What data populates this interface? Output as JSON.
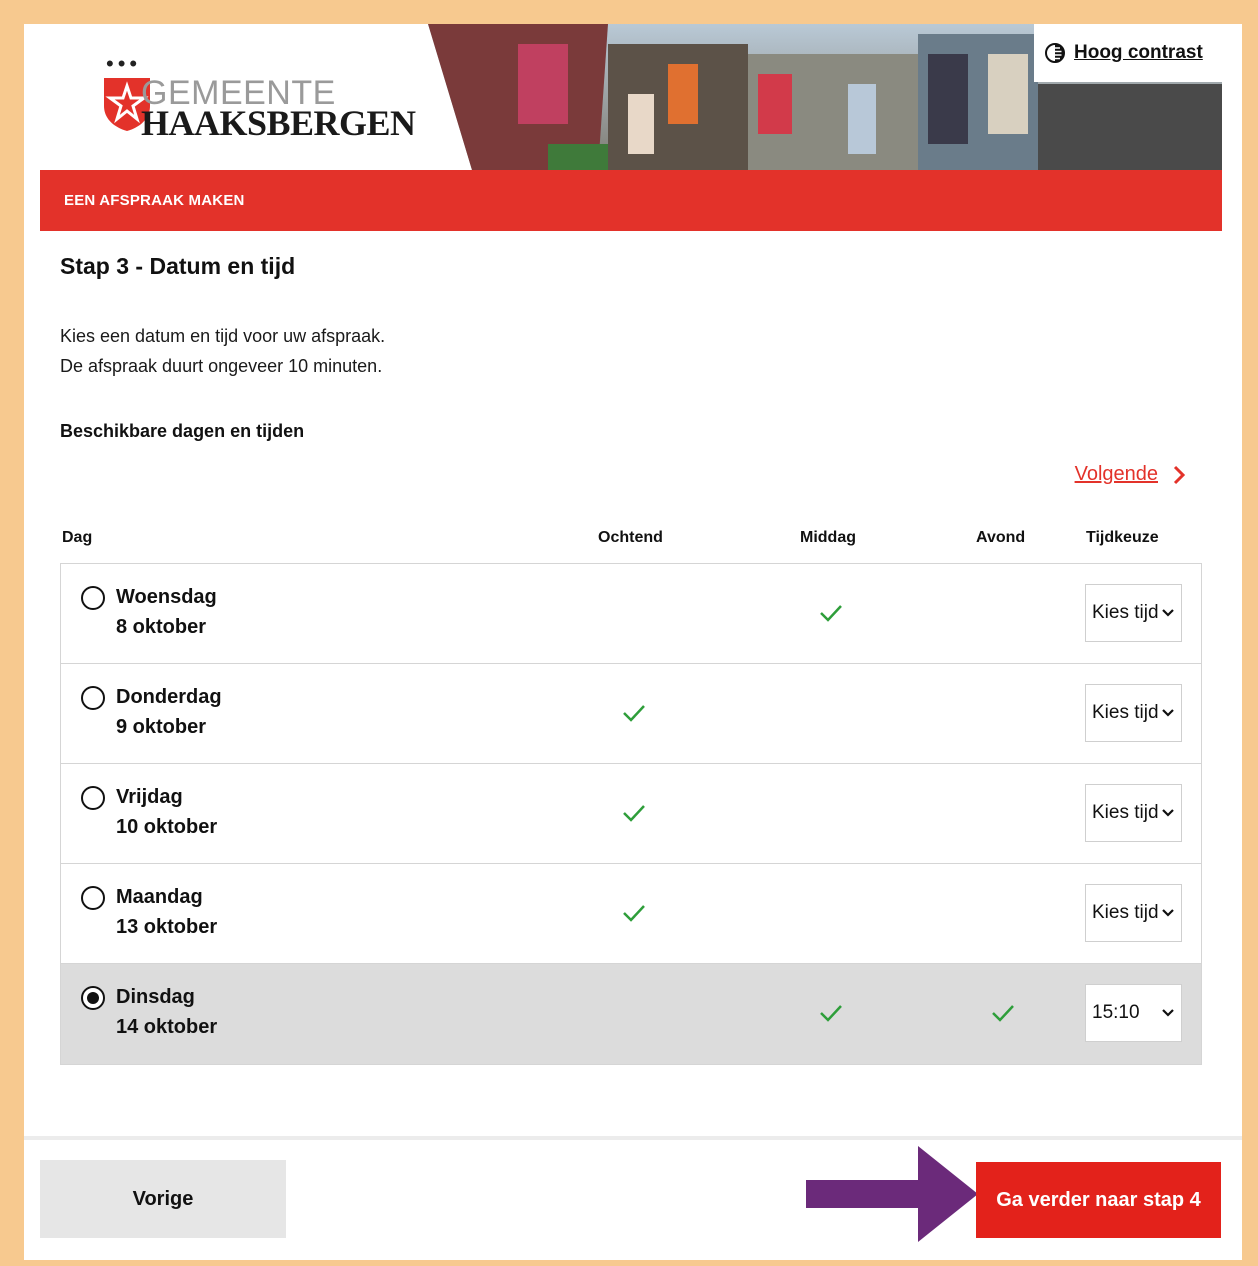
{
  "header": {
    "logo_line1": "GEMEENTE",
    "logo_line2": "HAAKSBERGEN",
    "contrast_label": "Hoog contrast"
  },
  "banner": {
    "title": "EEN AFSPRAAK MAKEN"
  },
  "page": {
    "step_title": "Stap 3 - Datum en tijd",
    "intro_line1": "Kies een datum en tijd voor uw afspraak.",
    "intro_line2": "De afspraak duurt ongeveer 10 minuten.",
    "section_title": "Beschikbare dagen en tijden",
    "next_link": "Volgende"
  },
  "table": {
    "columns": [
      "Dag",
      "Ochtend",
      "Middag",
      "Avond",
      "Tijdkeuze"
    ],
    "rows": [
      {
        "day": "Woensdag",
        "date": "8 oktober",
        "ochtend": false,
        "middag": true,
        "avond": false,
        "tijd": "Kies tijd",
        "selected": false
      },
      {
        "day": "Donderdag",
        "date": "9 oktober",
        "ochtend": true,
        "middag": false,
        "avond": false,
        "tijd": "Kies tijd",
        "selected": false
      },
      {
        "day": "Vrijdag",
        "date": "10 oktober",
        "ochtend": true,
        "middag": false,
        "avond": false,
        "tijd": "Kies tijd",
        "selected": false
      },
      {
        "day": "Maandag",
        "date": "13 oktober",
        "ochtend": true,
        "middag": false,
        "avond": false,
        "tijd": "Kies tijd",
        "selected": false
      },
      {
        "day": "Dinsdag",
        "date": "14 oktober",
        "ochtend": false,
        "middag": true,
        "avond": true,
        "tijd": "15:10",
        "selected": true
      }
    ]
  },
  "footer": {
    "prev_label": "Vorige",
    "next_label": "Ga verder naar stap 4"
  },
  "colors": {
    "brand_red": "#e3322a",
    "check_green": "#2e9e3a",
    "pointer_purple": "#6b2a7a",
    "page_border": "#f7c98f"
  }
}
